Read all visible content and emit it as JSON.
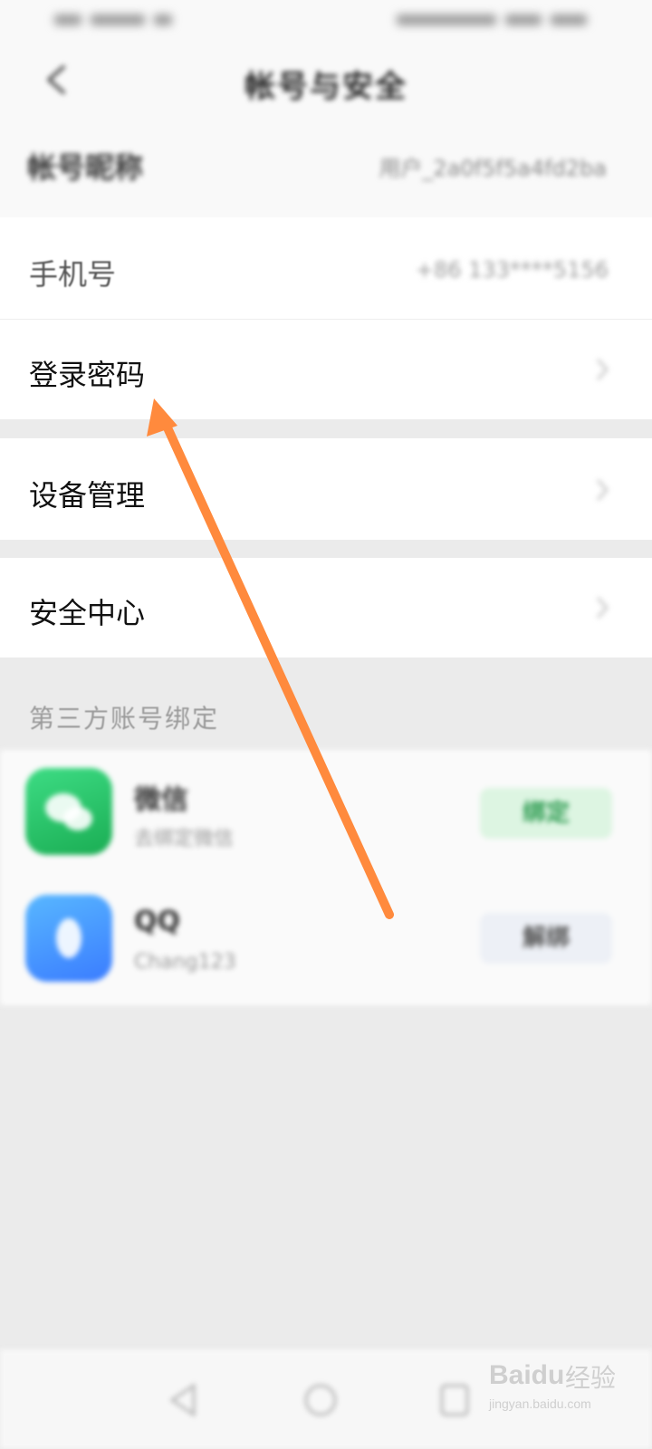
{
  "nav": {
    "title": "帐号与安全"
  },
  "profile": {
    "nickname_label": "帐号昵称",
    "nickname_value": "用户_2a0f5f5a4fd2ba"
  },
  "settings": {
    "phone_label": "手机号",
    "phone_value": "+86 133****5156",
    "password_label": "登录密码",
    "device_label": "设备管理",
    "security_label": "安全中心"
  },
  "third_party": {
    "section_label": "第三方账号绑定",
    "wechat": {
      "name": "微信",
      "status": "去绑定微信",
      "button": "绑定"
    },
    "qq": {
      "name": "QQ",
      "status": "Chang123",
      "button": "解绑"
    }
  },
  "watermark": {
    "brand": "Baidu",
    "cn": "经验",
    "url": "jingyan.baidu.com"
  },
  "colors": {
    "arrow": "#ff8a3d",
    "wechat": "#1aad53",
    "qq": "#3a7cff"
  },
  "icons": [
    "back-icon",
    "chevron-right-icon",
    "wechat-icon",
    "qq-icon",
    "back-triangle-icon",
    "home-circle-icon",
    "recent-square-icon"
  ]
}
